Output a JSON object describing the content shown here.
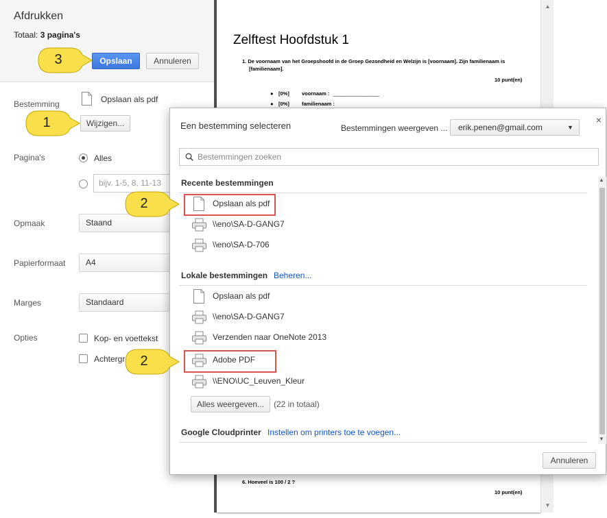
{
  "print": {
    "title": "Afdrukken",
    "total_label": "Totaal:",
    "total_value": "3 pagina's",
    "save_button": "Opslaan",
    "cancel_button": "Annuleren",
    "destination_label": "Bestemming",
    "destination_value": "Opslaan als pdf",
    "change_button": "Wijzigen...",
    "pages_label": "Pagina's",
    "pages_all": "Alles",
    "pages_range_placeholder": "bijv. 1-5, 8, 11-13",
    "layout_label": "Opmaak",
    "layout_value": "Staand",
    "paper_label": "Papierformaat",
    "paper_value": "A4",
    "margins_label": "Marges",
    "margins_value": "Standaard",
    "options_label": "Opties",
    "option_header_footer": "Kop- en voettekst",
    "option_background_partial": "Achtergro"
  },
  "preview": {
    "doc_title": "Zelftest Hoofdstuk 1",
    "q1_text_line1": "1. De voornaam van het Groepshoofd in de Groep Gezondheid en Welzijn is [voornaam]. Zijn familienaam is",
    "q1_text_line2": "[familienaam].",
    "q1_points": "10 punt(en)",
    "q1_ans1_pct": "[0%]",
    "q1_ans1_label": "voornaam :",
    "q1_ans1_blank": "________________",
    "q1_ans2_pct": "[0%]",
    "q1_ans2_label": "familienaam :",
    "q6_text": "6. Hoeveel is 100 / 2 ?",
    "q6_points": "10 punt(en)"
  },
  "dialog": {
    "title": "Een bestemming selecteren",
    "show_label": "Bestemmingen weergeven ...",
    "account": "erik.penen@gmail.com",
    "search_placeholder": "Bestemmingen zoeken",
    "recent_heading": "Recente bestemmingen",
    "recent_items": [
      {
        "label": "Opslaan als pdf",
        "icon": "file-icon"
      },
      {
        "label": "\\\\eno\\SA-D-GANG7",
        "icon": "printer-icon"
      },
      {
        "label": "\\\\eno\\SA-D-706",
        "icon": "printer-icon"
      }
    ],
    "local_heading": "Lokale bestemmingen",
    "manage_link": "Beheren...",
    "local_items": [
      {
        "label": "Opslaan als pdf",
        "icon": "file-icon"
      },
      {
        "label": "\\\\eno\\SA-D-GANG7",
        "icon": "printer-icon"
      },
      {
        "label": "Verzenden naar OneNote 2013",
        "icon": "printer-icon"
      },
      {
        "label": "Adobe PDF",
        "icon": "printer-icon"
      },
      {
        "label": "\\\\ENO\\UC_Leuven_Kleur",
        "icon": "printer-icon"
      }
    ],
    "show_all_button": "Alles weergeven...",
    "show_all_count": "(22 in totaal)",
    "cloud_heading": "Google Cloudprinter",
    "cloud_link": "Instellen om printers toe te voegen...",
    "cancel_button": "Annuleren",
    "close_symbol": "×"
  },
  "callouts": {
    "step1": "1",
    "step2a": "2",
    "step2b": "2",
    "step3": "3"
  },
  "colors": {
    "primary_button": "#3c78de",
    "highlight_box": "#d9534f",
    "callout_fill": "#f9e04a",
    "link": "#1155cc"
  }
}
